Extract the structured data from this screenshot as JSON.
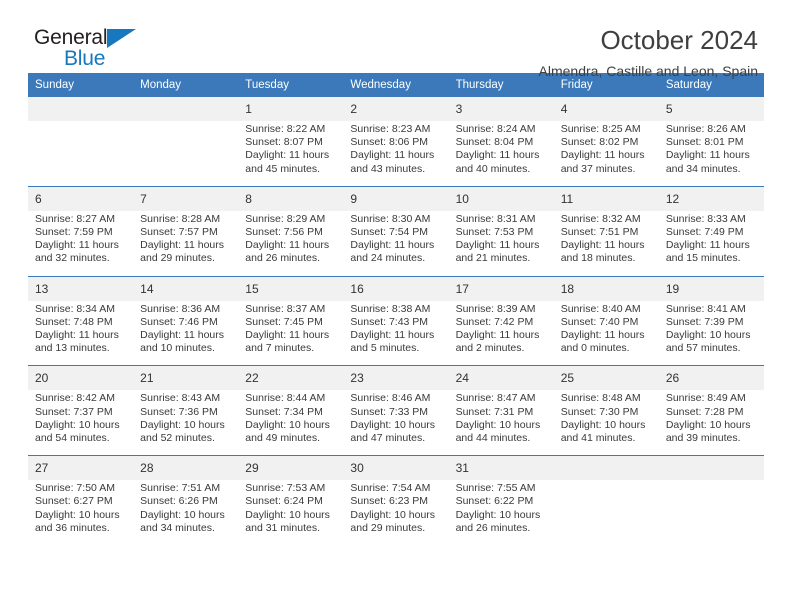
{
  "brand": {
    "name_top": "General",
    "name_bottom": "Blue",
    "accent_color": "#1878be",
    "header_color": "#3b79ba"
  },
  "header": {
    "title": "October 2024",
    "subtitle": "Almendra, Castille and Leon, Spain"
  },
  "calendar": {
    "weekday_headers": [
      "Sunday",
      "Monday",
      "Tuesday",
      "Wednesday",
      "Thursday",
      "Friday",
      "Saturday"
    ],
    "weeks": [
      [
        {
          "day": "",
          "sunrise": "",
          "sunset": "",
          "daylight_1": "",
          "daylight_2": ""
        },
        {
          "day": "",
          "sunrise": "",
          "sunset": "",
          "daylight_1": "",
          "daylight_2": ""
        },
        {
          "day": "1",
          "sunrise": "Sunrise: 8:22 AM",
          "sunset": "Sunset: 8:07 PM",
          "daylight_1": "Daylight: 11 hours",
          "daylight_2": "and 45 minutes."
        },
        {
          "day": "2",
          "sunrise": "Sunrise: 8:23 AM",
          "sunset": "Sunset: 8:06 PM",
          "daylight_1": "Daylight: 11 hours",
          "daylight_2": "and 43 minutes."
        },
        {
          "day": "3",
          "sunrise": "Sunrise: 8:24 AM",
          "sunset": "Sunset: 8:04 PM",
          "daylight_1": "Daylight: 11 hours",
          "daylight_2": "and 40 minutes."
        },
        {
          "day": "4",
          "sunrise": "Sunrise: 8:25 AM",
          "sunset": "Sunset: 8:02 PM",
          "daylight_1": "Daylight: 11 hours",
          "daylight_2": "and 37 minutes."
        },
        {
          "day": "5",
          "sunrise": "Sunrise: 8:26 AM",
          "sunset": "Sunset: 8:01 PM",
          "daylight_1": "Daylight: 11 hours",
          "daylight_2": "and 34 minutes."
        }
      ],
      [
        {
          "day": "6",
          "sunrise": "Sunrise: 8:27 AM",
          "sunset": "Sunset: 7:59 PM",
          "daylight_1": "Daylight: 11 hours",
          "daylight_2": "and 32 minutes."
        },
        {
          "day": "7",
          "sunrise": "Sunrise: 8:28 AM",
          "sunset": "Sunset: 7:57 PM",
          "daylight_1": "Daylight: 11 hours",
          "daylight_2": "and 29 minutes."
        },
        {
          "day": "8",
          "sunrise": "Sunrise: 8:29 AM",
          "sunset": "Sunset: 7:56 PM",
          "daylight_1": "Daylight: 11 hours",
          "daylight_2": "and 26 minutes."
        },
        {
          "day": "9",
          "sunrise": "Sunrise: 8:30 AM",
          "sunset": "Sunset: 7:54 PM",
          "daylight_1": "Daylight: 11 hours",
          "daylight_2": "and 24 minutes."
        },
        {
          "day": "10",
          "sunrise": "Sunrise: 8:31 AM",
          "sunset": "Sunset: 7:53 PM",
          "daylight_1": "Daylight: 11 hours",
          "daylight_2": "and 21 minutes."
        },
        {
          "day": "11",
          "sunrise": "Sunrise: 8:32 AM",
          "sunset": "Sunset: 7:51 PM",
          "daylight_1": "Daylight: 11 hours",
          "daylight_2": "and 18 minutes."
        },
        {
          "day": "12",
          "sunrise": "Sunrise: 8:33 AM",
          "sunset": "Sunset: 7:49 PM",
          "daylight_1": "Daylight: 11 hours",
          "daylight_2": "and 15 minutes."
        }
      ],
      [
        {
          "day": "13",
          "sunrise": "Sunrise: 8:34 AM",
          "sunset": "Sunset: 7:48 PM",
          "daylight_1": "Daylight: 11 hours",
          "daylight_2": "and 13 minutes."
        },
        {
          "day": "14",
          "sunrise": "Sunrise: 8:36 AM",
          "sunset": "Sunset: 7:46 PM",
          "daylight_1": "Daylight: 11 hours",
          "daylight_2": "and 10 minutes."
        },
        {
          "day": "15",
          "sunrise": "Sunrise: 8:37 AM",
          "sunset": "Sunset: 7:45 PM",
          "daylight_1": "Daylight: 11 hours",
          "daylight_2": "and 7 minutes."
        },
        {
          "day": "16",
          "sunrise": "Sunrise: 8:38 AM",
          "sunset": "Sunset: 7:43 PM",
          "daylight_1": "Daylight: 11 hours",
          "daylight_2": "and 5 minutes."
        },
        {
          "day": "17",
          "sunrise": "Sunrise: 8:39 AM",
          "sunset": "Sunset: 7:42 PM",
          "daylight_1": "Daylight: 11 hours",
          "daylight_2": "and 2 minutes."
        },
        {
          "day": "18",
          "sunrise": "Sunrise: 8:40 AM",
          "sunset": "Sunset: 7:40 PM",
          "daylight_1": "Daylight: 11 hours",
          "daylight_2": "and 0 minutes."
        },
        {
          "day": "19",
          "sunrise": "Sunrise: 8:41 AM",
          "sunset": "Sunset: 7:39 PM",
          "daylight_1": "Daylight: 10 hours",
          "daylight_2": "and 57 minutes."
        }
      ],
      [
        {
          "day": "20",
          "sunrise": "Sunrise: 8:42 AM",
          "sunset": "Sunset: 7:37 PM",
          "daylight_1": "Daylight: 10 hours",
          "daylight_2": "and 54 minutes."
        },
        {
          "day": "21",
          "sunrise": "Sunrise: 8:43 AM",
          "sunset": "Sunset: 7:36 PM",
          "daylight_1": "Daylight: 10 hours",
          "daylight_2": "and 52 minutes."
        },
        {
          "day": "22",
          "sunrise": "Sunrise: 8:44 AM",
          "sunset": "Sunset: 7:34 PM",
          "daylight_1": "Daylight: 10 hours",
          "daylight_2": "and 49 minutes."
        },
        {
          "day": "23",
          "sunrise": "Sunrise: 8:46 AM",
          "sunset": "Sunset: 7:33 PM",
          "daylight_1": "Daylight: 10 hours",
          "daylight_2": "and 47 minutes."
        },
        {
          "day": "24",
          "sunrise": "Sunrise: 8:47 AM",
          "sunset": "Sunset: 7:31 PM",
          "daylight_1": "Daylight: 10 hours",
          "daylight_2": "and 44 minutes."
        },
        {
          "day": "25",
          "sunrise": "Sunrise: 8:48 AM",
          "sunset": "Sunset: 7:30 PM",
          "daylight_1": "Daylight: 10 hours",
          "daylight_2": "and 41 minutes."
        },
        {
          "day": "26",
          "sunrise": "Sunrise: 8:49 AM",
          "sunset": "Sunset: 7:28 PM",
          "daylight_1": "Daylight: 10 hours",
          "daylight_2": "and 39 minutes."
        }
      ],
      [
        {
          "day": "27",
          "sunrise": "Sunrise: 7:50 AM",
          "sunset": "Sunset: 6:27 PM",
          "daylight_1": "Daylight: 10 hours",
          "daylight_2": "and 36 minutes."
        },
        {
          "day": "28",
          "sunrise": "Sunrise: 7:51 AM",
          "sunset": "Sunset: 6:26 PM",
          "daylight_1": "Daylight: 10 hours",
          "daylight_2": "and 34 minutes."
        },
        {
          "day": "29",
          "sunrise": "Sunrise: 7:53 AM",
          "sunset": "Sunset: 6:24 PM",
          "daylight_1": "Daylight: 10 hours",
          "daylight_2": "and 31 minutes."
        },
        {
          "day": "30",
          "sunrise": "Sunrise: 7:54 AM",
          "sunset": "Sunset: 6:23 PM",
          "daylight_1": "Daylight: 10 hours",
          "daylight_2": "and 29 minutes."
        },
        {
          "day": "31",
          "sunrise": "Sunrise: 7:55 AM",
          "sunset": "Sunset: 6:22 PM",
          "daylight_1": "Daylight: 10 hours",
          "daylight_2": "and 26 minutes."
        },
        {
          "day": "",
          "sunrise": "",
          "sunset": "",
          "daylight_1": "",
          "daylight_2": ""
        },
        {
          "day": "",
          "sunrise": "",
          "sunset": "",
          "daylight_1": "",
          "daylight_2": ""
        }
      ]
    ]
  }
}
